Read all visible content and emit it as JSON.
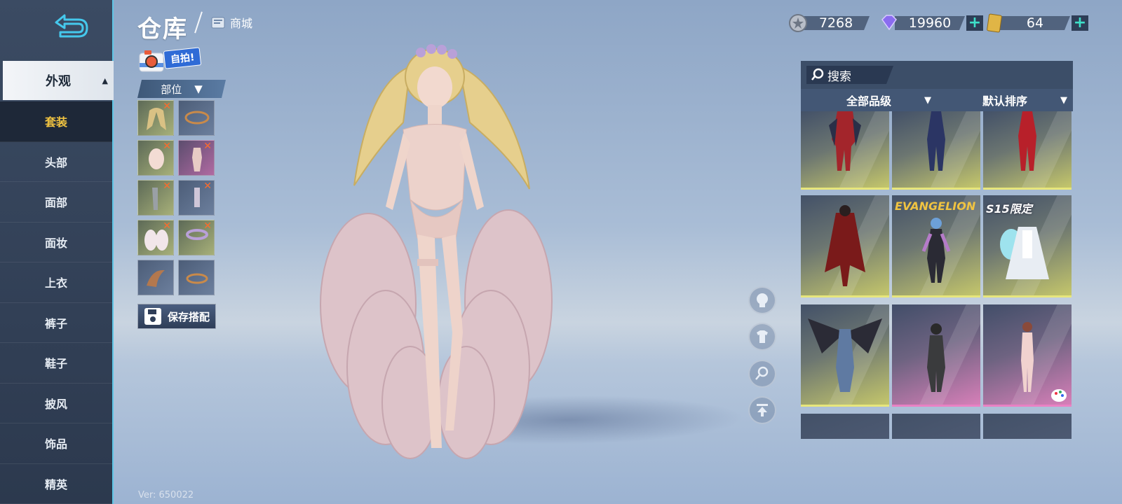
{
  "header": {
    "title": "仓库",
    "shop_label": "商城",
    "selfie_label": "自拍!",
    "version": "Ver: 650022"
  },
  "currency": {
    "silver": "7268",
    "diamond": "19960",
    "ticket": "64"
  },
  "sidebar": {
    "expanded_category": "外观",
    "items": [
      {
        "label": "套装",
        "active": true
      },
      {
        "label": "头部"
      },
      {
        "label": "面部"
      },
      {
        "label": "面妆"
      },
      {
        "label": "上衣"
      },
      {
        "label": "裤子"
      },
      {
        "label": "鞋子"
      },
      {
        "label": "披风"
      },
      {
        "label": "饰品"
      },
      {
        "label": "精英"
      }
    ]
  },
  "parts": {
    "filter_label": "部位",
    "save_label": "保存搭配"
  },
  "panel": {
    "search_label": "搜索",
    "filter_quality": "全部品级",
    "filter_sort": "默认排序",
    "badges": {
      "eva": "EVANGELION",
      "s15": "S15限定"
    }
  },
  "colors": {
    "accent": "#5ec6e6",
    "active_text": "#f0c341",
    "plus": "#3ee0c9",
    "remove": "#ff6b2b"
  }
}
